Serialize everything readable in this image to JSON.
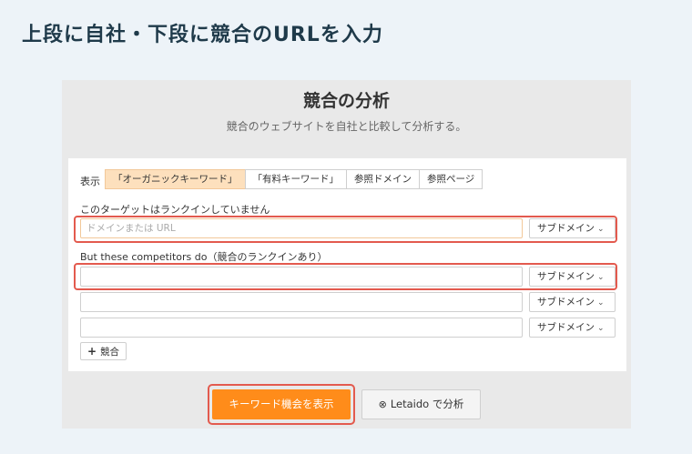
{
  "page_heading": "上段に自社・下段に競合のURLを入力",
  "panel": {
    "title": "競合の分析",
    "subtitle": "競合のウェブサイトを自社と比較して分析する。"
  },
  "display": {
    "label": "表示",
    "tabs": [
      {
        "label": "「オーガニックキーワード」",
        "active": true
      },
      {
        "label": "「有料キーワード」",
        "active": false
      },
      {
        "label": "参照ドメイン",
        "active": false
      },
      {
        "label": "参照ページ",
        "active": false
      }
    ]
  },
  "target": {
    "label": "このターゲットはランクインしていません",
    "input_placeholder": "ドメインまたは URL",
    "input_value": "",
    "scope": "サブドメイン"
  },
  "competitors": {
    "label": "But these competitors do（競合のランクインあり）",
    "rows": [
      {
        "value": "",
        "scope": "サブドメイン"
      },
      {
        "value": "",
        "scope": "サブドメイン"
      },
      {
        "value": "",
        "scope": "サブドメイン"
      }
    ],
    "add_label": "競合"
  },
  "actions": {
    "primary_label": "キーワード機会を表示",
    "secondary_label": "Letaido で分析"
  },
  "icons": {
    "chevron": "chevron-down-icon",
    "plus": "plus-icon",
    "secondary": "circle-x-icon"
  },
  "colors": {
    "accent": "#ff8c1a",
    "active_tab": "#fde0bd",
    "highlight": "#e35a4e",
    "heading": "#1f3a4a"
  }
}
